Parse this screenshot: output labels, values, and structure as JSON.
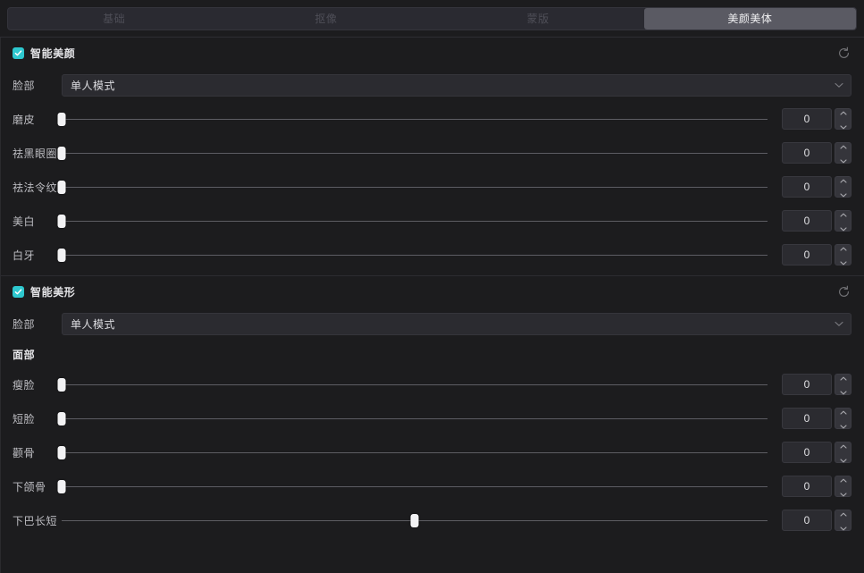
{
  "tabs": [
    {
      "label": "基础",
      "active": false
    },
    {
      "label": "抠像",
      "active": false
    },
    {
      "label": "蒙版",
      "active": false
    },
    {
      "label": "美颜美体",
      "active": true
    }
  ],
  "colors": {
    "accent": "#2ec8cf",
    "panel_bg": "#1c1c1e",
    "tab_active_bg": "#5a5a63",
    "field_bg": "#2b2b30",
    "track": "#5d5d63",
    "knob": "#f2f2f4"
  },
  "sections": [
    {
      "title": "智能美颜",
      "enabled": true,
      "reset_icon": "reset-circular-arrow-icon",
      "select": {
        "label": "脸部",
        "value": "单人模式",
        "chevron_icon": "chevron-down-icon"
      },
      "sliders": [
        {
          "label": "磨皮",
          "value": "0",
          "percent": 0
        },
        {
          "label": "祛黑眼圈",
          "value": "0",
          "percent": 0
        },
        {
          "label": "祛法令纹",
          "value": "0",
          "percent": 0
        },
        {
          "label": "美白",
          "value": "0",
          "percent": 0
        },
        {
          "label": "白牙",
          "value": "0",
          "percent": 0
        }
      ]
    },
    {
      "title": "智能美形",
      "enabled": true,
      "reset_icon": "reset-circular-arrow-icon",
      "select": {
        "label": "脸部",
        "value": "单人模式",
        "chevron_icon": "chevron-down-icon"
      },
      "subsection": "面部",
      "sliders": [
        {
          "label": "瘦脸",
          "value": "0",
          "percent": 0
        },
        {
          "label": "短脸",
          "value": "0",
          "percent": 0
        },
        {
          "label": "颧骨",
          "value": "0",
          "percent": 0
        },
        {
          "label": "下颌骨",
          "value": "0",
          "percent": 0
        },
        {
          "label": "下巴长短",
          "value": "0",
          "percent": 50
        }
      ]
    }
  ]
}
